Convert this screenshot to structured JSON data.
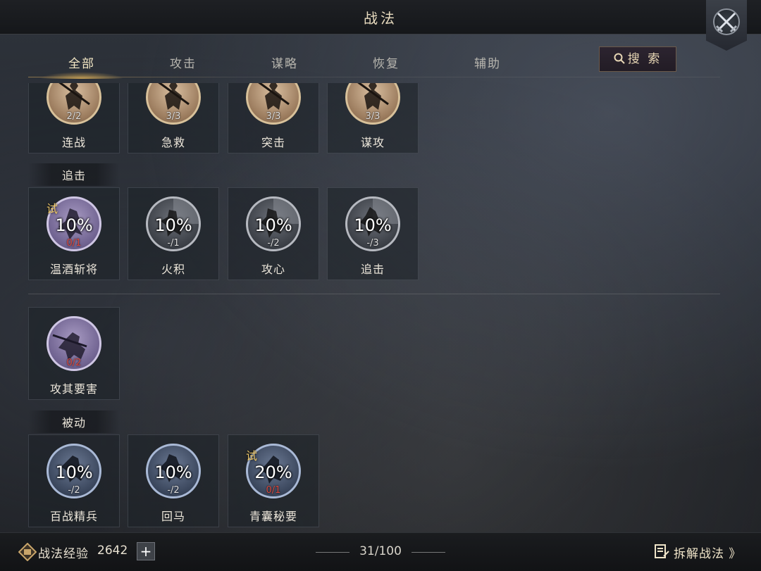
{
  "header": {
    "title": "战法"
  },
  "tabs": [
    {
      "label": "全部",
      "active": true
    },
    {
      "label": "攻击",
      "active": false
    },
    {
      "label": "谋略",
      "active": false
    },
    {
      "label": "恢复",
      "active": false
    },
    {
      "label": "辅助",
      "active": false
    }
  ],
  "search": {
    "label": "搜 索"
  },
  "sections": {
    "top_row": [
      {
        "name": "连战",
        "count": "2/2"
      },
      {
        "name": "急救",
        "count": "3/3"
      },
      {
        "name": "突击",
        "count": "3/3"
      },
      {
        "name": "谋攻",
        "count": "3/3"
      }
    ],
    "pursuit": {
      "label": "追击",
      "items": [
        {
          "name": "温酒斩将",
          "percent": "10%",
          "count": "0/1",
          "trial": "试"
        },
        {
          "name": "火积",
          "percent": "10%",
          "count": "-/1"
        },
        {
          "name": "攻心",
          "percent": "10%",
          "count": "-/2"
        },
        {
          "name": "追击",
          "percent": "10%",
          "count": "-/3"
        }
      ]
    },
    "misc": {
      "items": [
        {
          "name": "攻其要害",
          "count": "0/2"
        }
      ]
    },
    "passive": {
      "label": "被动",
      "items": [
        {
          "name": "百战精兵",
          "percent": "10%",
          "count": "-/2"
        },
        {
          "name": "回马",
          "percent": "10%",
          "count": "-/2"
        },
        {
          "name": "青囊秘要",
          "percent": "20%",
          "count": "0/1",
          "trial": "试"
        }
      ]
    }
  },
  "footer": {
    "exp_label": "战法经验",
    "exp_value": "2642",
    "add_label": "+",
    "page": "31/100",
    "decompose_label": "拆解战法 》"
  },
  "colors": {
    "accent_gold": "#f0c968",
    "count_red": "#d9473c"
  }
}
